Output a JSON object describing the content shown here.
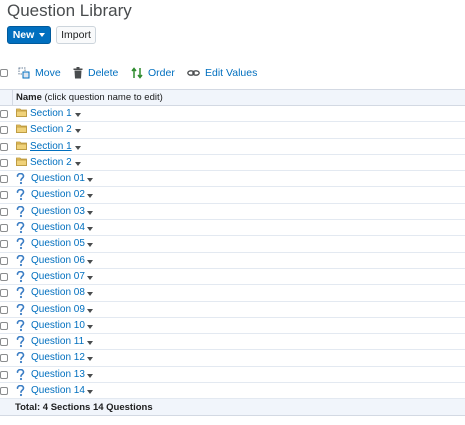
{
  "page": {
    "title": "Question Library"
  },
  "actions": {
    "new_label": "New",
    "import_label": "Import"
  },
  "toolbar": {
    "move": "Move",
    "delete": "Delete",
    "order": "Order",
    "edit_values": "Edit Values"
  },
  "table": {
    "header_bold": "Name",
    "header_rest": " (click question name to edit)",
    "rows": [
      {
        "type": "section",
        "label": "Section 1",
        "underline": false
      },
      {
        "type": "section",
        "label": "Section 2",
        "underline": false
      },
      {
        "type": "section",
        "label": "Section 1",
        "underline": true
      },
      {
        "type": "section",
        "label": "Section 2",
        "underline": false
      },
      {
        "type": "question",
        "label": "Question 01"
      },
      {
        "type": "question",
        "label": "Question 02"
      },
      {
        "type": "question",
        "label": "Question 03"
      },
      {
        "type": "question",
        "label": "Question 04"
      },
      {
        "type": "question",
        "label": "Question 05"
      },
      {
        "type": "question",
        "label": "Question 06"
      },
      {
        "type": "question",
        "label": "Question 07"
      },
      {
        "type": "question",
        "label": "Question 08"
      },
      {
        "type": "question",
        "label": "Question 09"
      },
      {
        "type": "question",
        "label": "Question 10"
      },
      {
        "type": "question",
        "label": "Question 11"
      },
      {
        "type": "question",
        "label": "Question 12"
      },
      {
        "type": "question",
        "label": "Question 13"
      },
      {
        "type": "question",
        "label": "Question 14"
      }
    ],
    "footer": "Total:  4 Sections    14 Questions"
  },
  "colors": {
    "accent": "#006fbf",
    "folder": "#e8c25e",
    "header_bg": "#f1f5fb"
  }
}
